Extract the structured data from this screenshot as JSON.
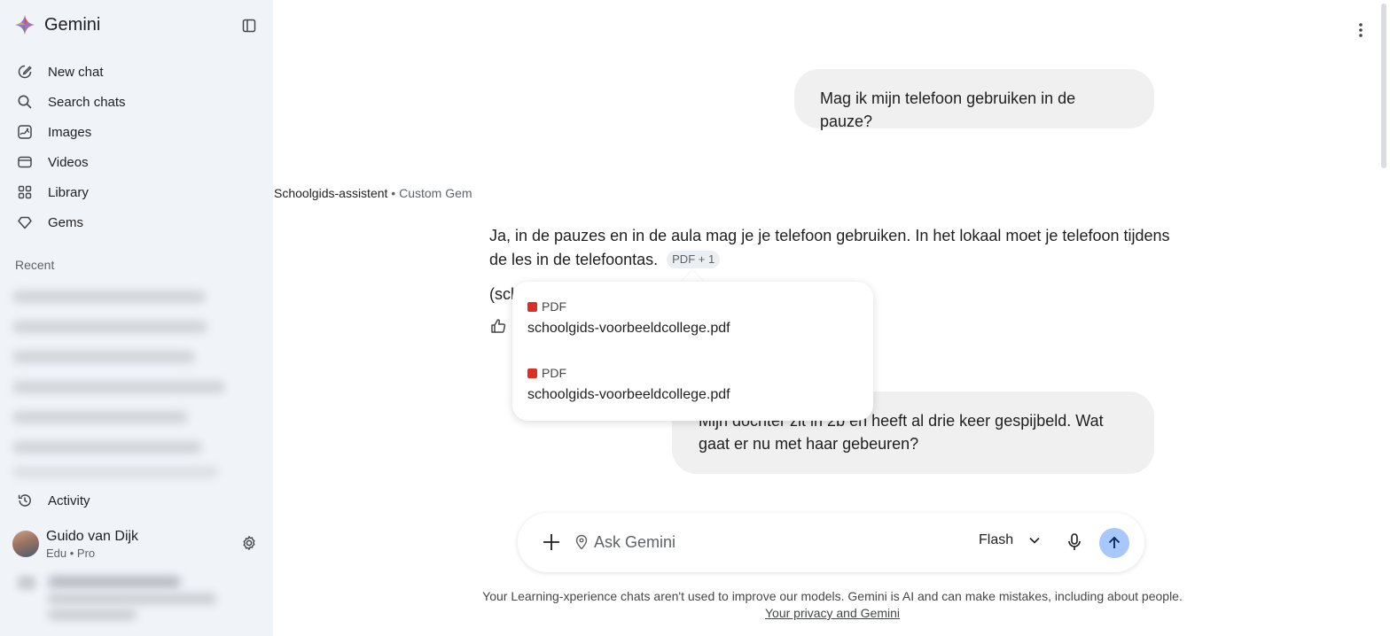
{
  "app": {
    "brand": "Gemini"
  },
  "sidebar": {
    "items": [
      {
        "label": "New chat",
        "icon": "new-chat-icon"
      },
      {
        "label": "Search chats",
        "icon": "search-icon"
      },
      {
        "label": "Images",
        "icon": "images-icon"
      },
      {
        "label": "Videos",
        "icon": "videos-icon"
      },
      {
        "label": "Library",
        "icon": "library-icon"
      },
      {
        "label": "Gems",
        "icon": "gems-icon"
      }
    ],
    "recent_label": "Recent",
    "activity_label": "Activity",
    "user": {
      "name": "Guido van Dijk",
      "plan": "Edu • Pro"
    }
  },
  "conversation": {
    "user_message_1": "Mag ik mijn telefoon gebruiken in de pauze?",
    "gem_name": "Schoolgids-assistent",
    "gem_separator": " • ",
    "gem_type": "Custom Gem",
    "answer_text": "Ja, in de pauzes en in de aula mag je je telefoon gebruiken. In het lokaal moet je telefoon tijdens de les in de telefoontas.",
    "citation_chip": "PDF + 1",
    "answer_partial": "(scl",
    "user_message_2": "Mijn dochter zit in 2b en heeft al drie keer gespijbeld. Wat gaat er nu met haar gebeuren?"
  },
  "sources_popup": {
    "sources": [
      {
        "type": "PDF",
        "file": "schoolgids-voorbeeldcollege.pdf"
      },
      {
        "type": "PDF",
        "file": "schoolgids-voorbeeldcollege.pdf"
      }
    ]
  },
  "composer": {
    "placeholder": "Ask Gemini",
    "model": "Flash"
  },
  "footer": {
    "disclaimer": "Your Learning-xperience chats aren't used to improve our models. Gemini is AI and can make mistakes, including about people.",
    "privacy_link": "Your privacy and Gemini"
  },
  "colors": {
    "accent": "#a8c7fa",
    "sidebar_bg": "#f0f4f9",
    "pdf_red": "#d93025"
  }
}
